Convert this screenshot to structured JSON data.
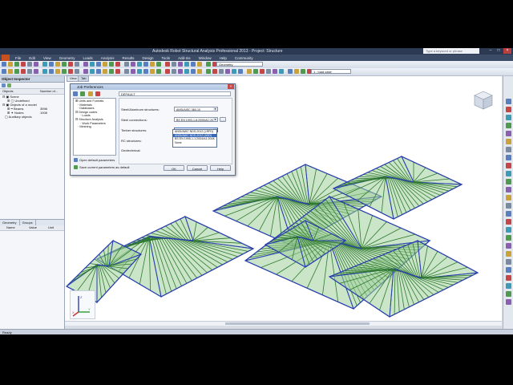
{
  "window": {
    "title": "Autodesk Robot Structural Analysis Professional 2013 - Project: Structure",
    "search_placeholder": "Type a keyword or phrase"
  },
  "menu": [
    "File",
    "Edit",
    "View",
    "Geometry",
    "Loads",
    "Analysis",
    "Results",
    "Design",
    "Tools",
    "Add-Ins",
    "Window",
    "Help",
    "Community"
  ],
  "toolbar": {
    "layout_combo": "Geometry",
    "case_combo": "1 : load case"
  },
  "object_inspector": {
    "title": "Object Inspector",
    "columns": [
      "Objects",
      "Number of..."
    ],
    "tree": [
      "Scene",
      "Undefined",
      "Objects of a model",
      "Beams",
      "Nodes",
      "Auxiliary objects"
    ],
    "counts": [
      "3598",
      "1008"
    ],
    "bottom_tabs": [
      "Geometry",
      "Groups"
    ],
    "grid_cols": [
      "Name",
      "Value",
      "Unit"
    ]
  },
  "viewport": {
    "tabs": [
      "View",
      "Tab"
    ]
  },
  "dialog": {
    "title": "Job Preferences",
    "path": "DEFAULT",
    "tree": [
      "Units and Formats",
      "Materials",
      "Databases",
      "Design codes",
      "Loads",
      "Structure Analysis",
      "Work Parameters",
      "Meshing"
    ],
    "fields": [
      {
        "label": "Steel/Aluminum structures:",
        "value": "ANSI/AISC 360-10"
      },
      {
        "label": "Steel connections:",
        "value": "BS EN 1993-1-8:2005/AC:2009"
      },
      {
        "label": "Timber structures:",
        "value": "ANSI/AWC NDS-2012 (LRFD)"
      },
      {
        "label": "RC structures:",
        "value": ""
      },
      {
        "label": "Geotechnical:",
        "value": ""
      }
    ],
    "dropdown": [
      "ANSI/AWC NDS-2012 (LRFD)",
      "ANSI/AWC NDS-2012 (ASD)",
      "BS EN 1995-1-1:2004/A1:2008",
      "None"
    ],
    "dropdown_selected": 1,
    "link_default": "Open default parameters",
    "link_save": "Save current parameters as default",
    "buttons": {
      "ok": "OK",
      "cancel": "Cancel",
      "help": "Help"
    }
  },
  "status": {
    "text": "Ready"
  },
  "colors": {
    "members": "#2f7a2f",
    "members_fill": "#9ecf9a",
    "beams_blue": "#2a3fae",
    "accent": "#3667b8"
  }
}
